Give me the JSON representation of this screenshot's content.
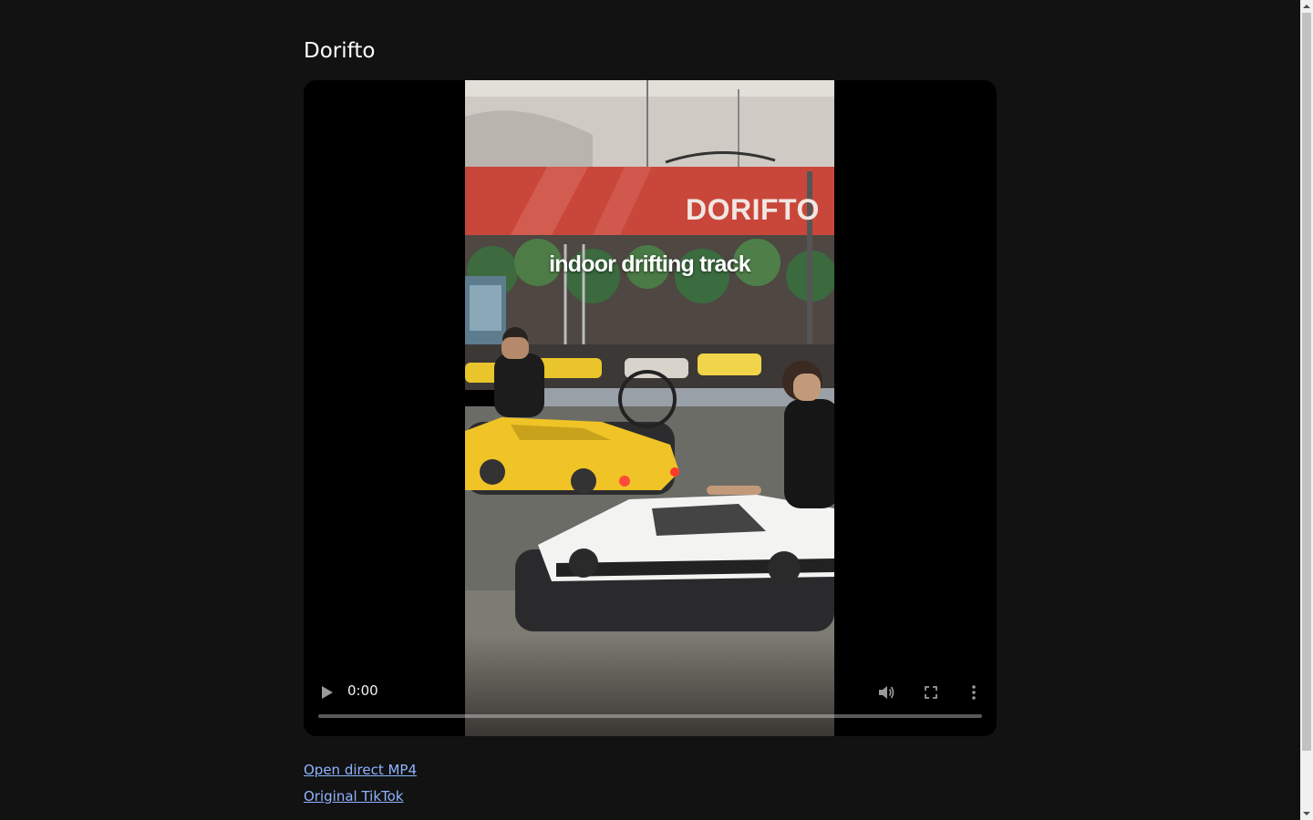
{
  "page": {
    "title": "Dorifto"
  },
  "video": {
    "caption": "indoor drifting track",
    "banner": "DORIFTO",
    "current_time": "0:00",
    "progress": 0,
    "controls": {
      "play_icon": "play-icon",
      "volume_icon": "volume-icon",
      "fullscreen_icon": "fullscreen-icon",
      "more_icon": "more-options-icon"
    }
  },
  "links": {
    "direct_mp4": "Open direct MP4",
    "original_tiktok": "Original TikTok"
  },
  "colors": {
    "background": "#121212",
    "link": "#8fb3ff",
    "banner_red": "#c9473a"
  }
}
